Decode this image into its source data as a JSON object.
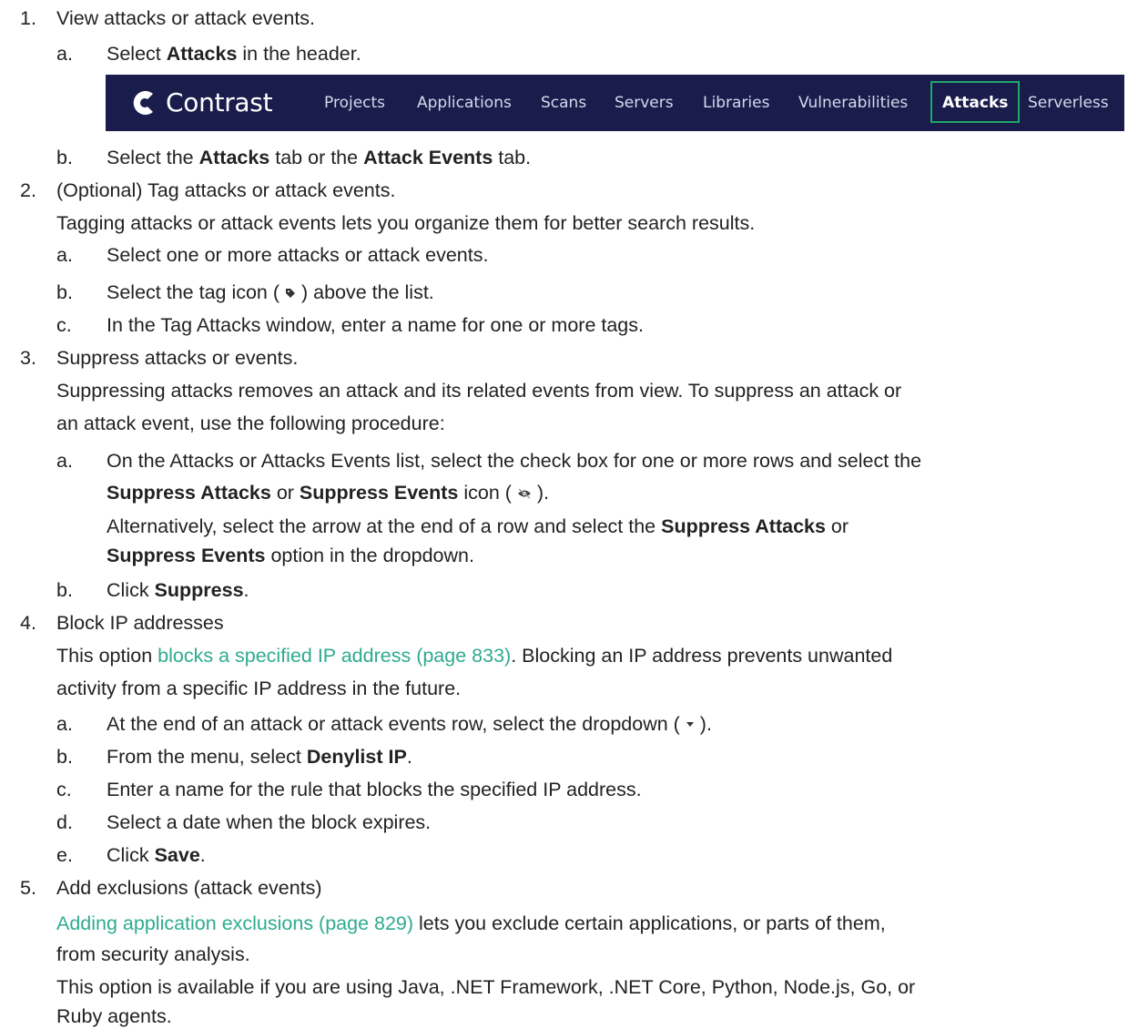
{
  "header": {
    "logo_text": "Contrast",
    "nav": [
      "Projects",
      "Applications",
      "Scans",
      "Servers",
      "Libraries",
      "Vulnerabilities",
      "Attacks",
      "Serverless"
    ],
    "active": "Attacks"
  },
  "steps": {
    "s1": {
      "num": "1.",
      "title": "View attacks or attack events.",
      "a": {
        "letter": "a.",
        "pre": "Select ",
        "b1": "Attacks",
        "post": " in the header."
      },
      "b": {
        "letter": "b.",
        "pre": "Select the ",
        "b1": "Attacks",
        "mid": " tab or the ",
        "b2": "Attack Events",
        "post": " tab."
      }
    },
    "s2": {
      "num": "2.",
      "title": "(Optional) Tag attacks or attack events.",
      "desc": "Tagging attacks or attack events lets you organize them for better search results.",
      "a": {
        "letter": "a.",
        "text": "Select one or more attacks or attack events."
      },
      "b": {
        "letter": "b.",
        "pre": "Select the tag icon ( ",
        "post": " ) above the list."
      },
      "c": {
        "letter": "c.",
        "text": "In the Tag Attacks window, enter a name for one or more tags."
      }
    },
    "s3": {
      "num": "3.",
      "title": "Suppress attacks or events.",
      "desc1": "Suppressing attacks removes an attack and its related events from view. To suppress an attack or",
      "desc2": "an attack event, use the following procedure:",
      "a": {
        "letter": "a.",
        "line1": "On the Attacks or Attacks Events list, select the check box for one or more rows and select the",
        "b1": "Suppress Attacks",
        "mid": " or ",
        "b2": "Suppress Events",
        "post_pre": " icon ( ",
        "post_end": " ).",
        "alt1": "Alternatively, select the arrow at the end of a row and select the ",
        "alt_b1": "Suppress Attacks",
        "alt_or": " or",
        "alt_b2": "Suppress Events",
        "alt_end": " option in the dropdown."
      },
      "b": {
        "letter": "b.",
        "pre": "Click ",
        "b1": "Suppress",
        "post": "."
      }
    },
    "s4": {
      "num": "4.",
      "title": "Block IP addresses",
      "desc_pre": "This option ",
      "desc_link": "blocks a specified IP address (page 833)",
      "desc_post": ". Blocking an IP address prevents unwanted",
      "desc2": "activity from a specific IP address in the future.",
      "a": {
        "letter": "a.",
        "pre": "At the end of an attack or attack events row, select the dropdown ( ",
        "post": " )."
      },
      "b": {
        "letter": "b.",
        "pre": "From the menu, select ",
        "b1": "Denylist IP",
        "post": "."
      },
      "c": {
        "letter": "c.",
        "text": "Enter a name for the rule that blocks the specified IP address."
      },
      "d": {
        "letter": "d.",
        "text": "Select a date when the block expires."
      },
      "e": {
        "letter": "e.",
        "pre": "Click ",
        "b1": "Save",
        "post": "."
      }
    },
    "s5": {
      "num": "5.",
      "title": "Add exclusions (attack events)",
      "link": "Adding application exclusions (page 829)",
      "link_post": " lets you exclude certain applications, or parts of them,",
      "desc2": "from security analysis.",
      "desc3": "This option is available if you are using Java, .NET Framework, .NET Core, Python, Node.js, Go, or",
      "desc4": "Ruby agents."
    }
  },
  "colors": {
    "link": "#2eab8f",
    "navbar": "#1a1d4b",
    "active_border": "#1fa76a"
  }
}
